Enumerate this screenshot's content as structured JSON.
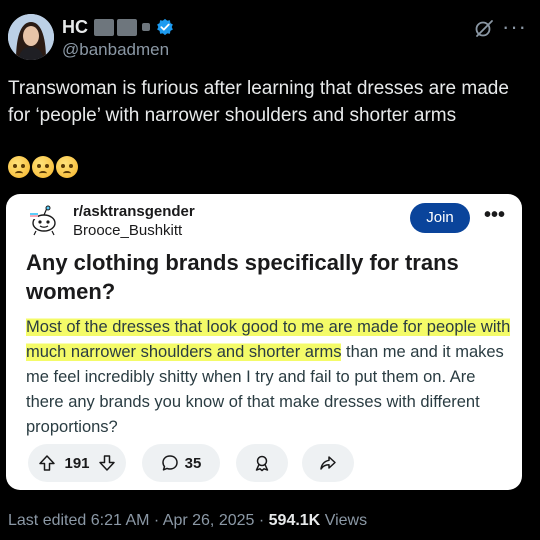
{
  "tweet": {
    "author_name": "HC",
    "handle": "@banbadmen",
    "text": "Transwoman is furious after learning that dresses are made for ‘people’ with narrower shoulders and shorter arms",
    "emojis": [
      "🥺",
      "🥺",
      "🥺"
    ]
  },
  "embedded_post": {
    "subreddit": "r/asktransgender",
    "username": "Brooce_Bushkitt",
    "join_label": "Join",
    "title": "Any clothing brands specifically for trans women?",
    "body_highlighted": "Most of the dresses that look good to me are made for people with much narrower shoulders and shorter arms",
    "body_rest": " than me and it makes me feel incredibly shitty when I try and fail to put them on. Are there any brands you know of that make dresses with different proportions?",
    "upvotes": "191",
    "comments": "35"
  },
  "footer": {
    "edited_label": "Last edited",
    "time": "6:21 AM",
    "separator": "·",
    "date": "Apr 26, 2025",
    "views_count": "594.1K",
    "views_label": "Views"
  },
  "colors": {
    "background": "#000000",
    "text": "#e7e9ea",
    "secondary_text": "#8b98a5",
    "verified_badge": "#1d9bf0",
    "join_button": "#0a449b",
    "highlight": "#f4fb68"
  }
}
